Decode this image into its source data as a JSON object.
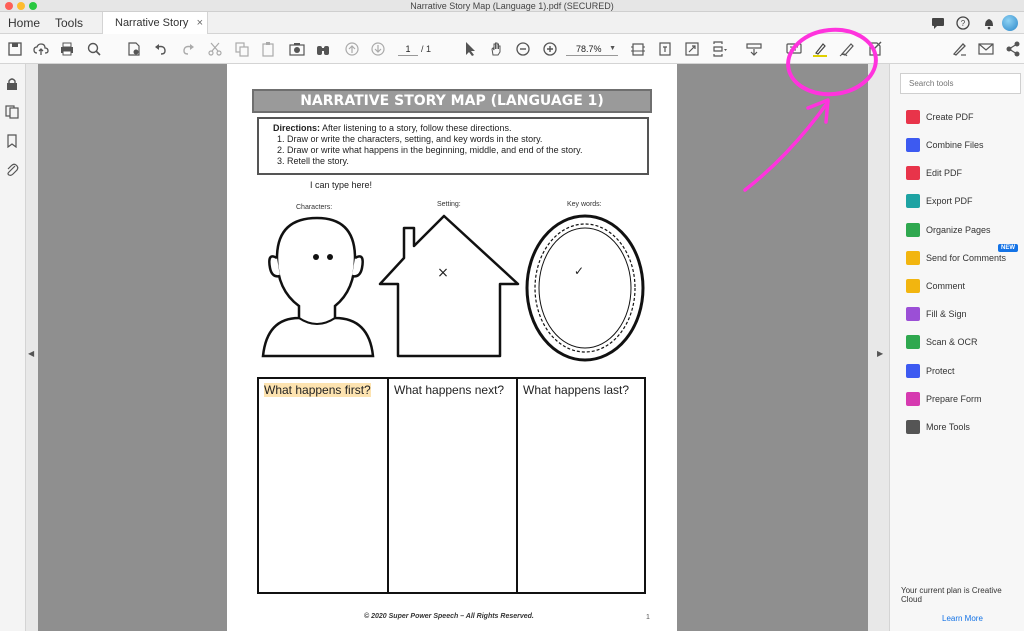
{
  "window": {
    "title": "Narrative Story Map (Language 1).pdf (SECURED)"
  },
  "tabs": {
    "home": "Home",
    "tools": "Tools",
    "document": "Narrative Story M...",
    "close": "×"
  },
  "toolbar": {
    "page_current": "1",
    "page_total": "/ 1",
    "zoom": "78.7%",
    "icons": [
      "save-icon",
      "upload-icon",
      "print-icon",
      "search-icon",
      "protect-icon",
      "undo-icon",
      "redo-icon",
      "cut-icon",
      "copy-icon",
      "paste-icon",
      "snapshot-icon",
      "binoculars-icon",
      "page-up-icon",
      "page-down-icon",
      "select-cursor-icon",
      "hand-icon",
      "zoom-out-icon",
      "zoom-in-icon",
      "fit-page-icon",
      "scroll-mode-icon",
      "full-screen-icon",
      "page-display-icon",
      "read-aloud-icon",
      "comment-icon",
      "highlight-icon",
      "draw-icon",
      "stamp-icon",
      "sign-icon",
      "email-icon",
      "share-icon"
    ]
  },
  "tools_pane": {
    "search_placeholder": "Search tools",
    "items": [
      {
        "label": "Create PDF",
        "color": "#e8344a",
        "icon": "create-pdf-icon"
      },
      {
        "label": "Combine Files",
        "color": "#3d5af1",
        "icon": "combine-files-icon"
      },
      {
        "label": "Edit PDF",
        "color": "#e8344a",
        "icon": "edit-pdf-icon"
      },
      {
        "label": "Export PDF",
        "color": "#1ea3a3",
        "icon": "export-pdf-icon"
      },
      {
        "label": "Organize Pages",
        "color": "#2fa84f",
        "icon": "organize-pages-icon"
      },
      {
        "label": "Send for Comments",
        "color": "#f2b50f",
        "icon": "send-comments-icon"
      },
      {
        "label": "Comment",
        "color": "#f2b50f",
        "icon": "comment-icon"
      },
      {
        "label": "Fill & Sign",
        "color": "#9b4fd6",
        "icon": "fill-sign-icon"
      },
      {
        "label": "Scan & OCR",
        "color": "#2fa84f",
        "icon": "scan-ocr-icon"
      },
      {
        "label": "Protect",
        "color": "#3d5af1",
        "icon": "protect-icon"
      },
      {
        "label": "Prepare Form",
        "color": "#d63ab0",
        "icon": "prepare-form-icon"
      },
      {
        "label": "More Tools",
        "color": "#555555",
        "icon": "more-tools-icon"
      }
    ],
    "new_badge": "NEW",
    "plan_text": "Your current plan is Creative Cloud",
    "learn_more": "Learn More"
  },
  "worksheet": {
    "title": "NARRATIVE STORY MAP (LANGUAGE 1)",
    "directions_label": "Directions:",
    "directions_text": " After listening to a story, follow these directions.",
    "steps": [
      "Draw or write the characters, setting, and key words in the story.",
      "Draw or write what happens in the beginning, middle, and end of the story.",
      "Retell the story."
    ],
    "typed_note": "I can type here!",
    "captions": {
      "characters": "Characters:",
      "setting": "Setting:",
      "key_words": "Key words:"
    },
    "setting_mark": "×",
    "keywords_mark": "✓",
    "boxes": [
      "What happens first?",
      "What happens next?",
      "What happens last?"
    ],
    "highlight_color": "#fde3b0",
    "footer": "© 2020 Super Power Speech – All Rights Reserved.",
    "page_number": "1"
  },
  "annotation": {
    "color": "#ff33dd"
  }
}
